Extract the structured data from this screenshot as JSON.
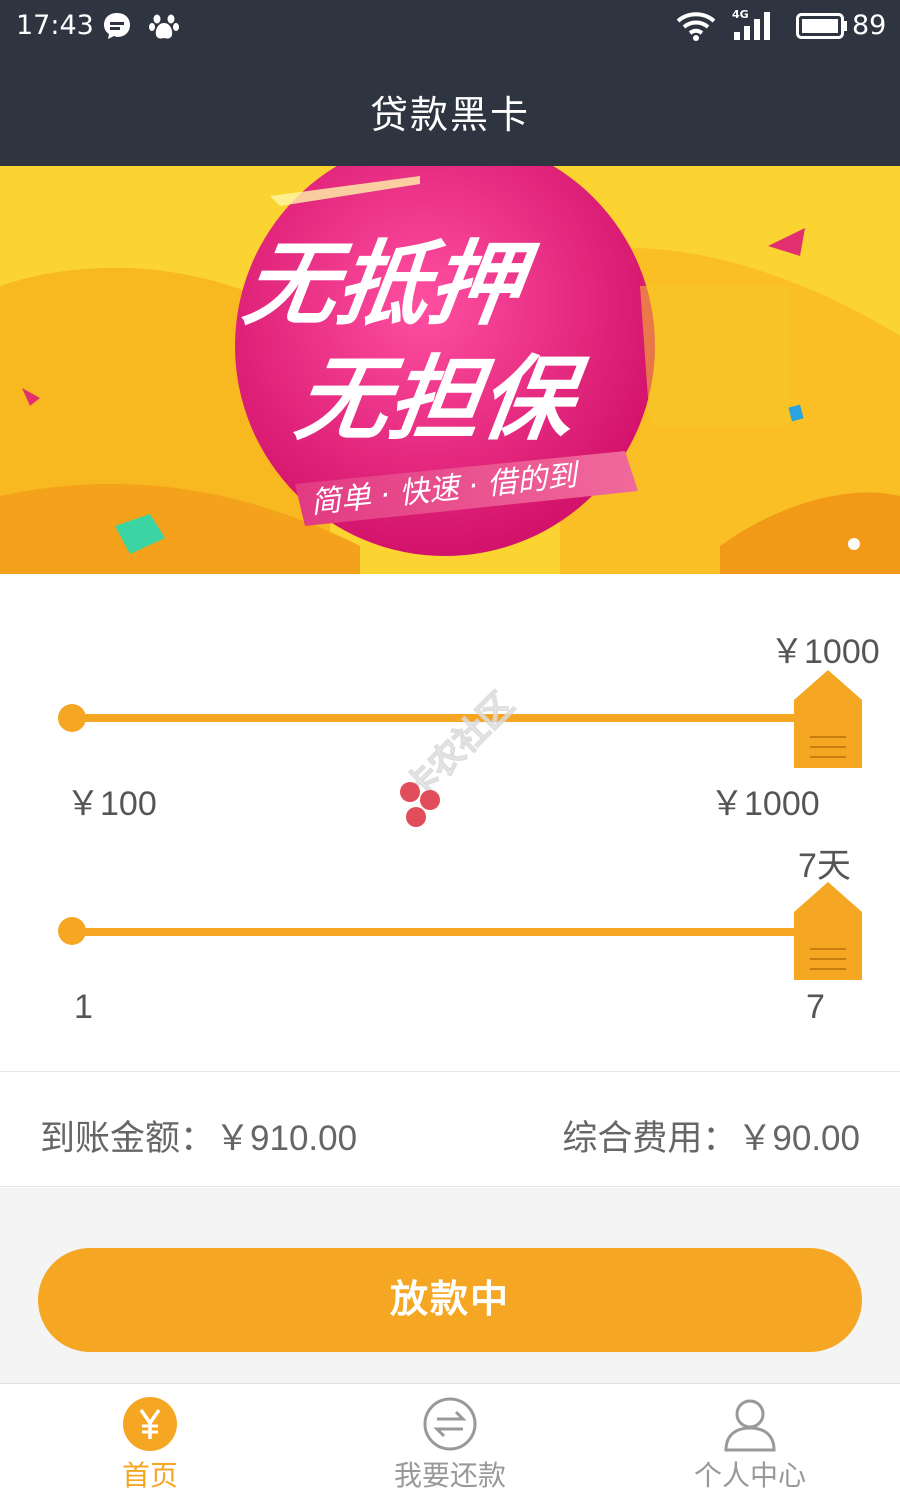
{
  "status_bar": {
    "time": "17:43",
    "network_label": "4G",
    "battery": "89"
  },
  "header": {
    "title": "贷款黑卡"
  },
  "banner": {
    "line1": "无抵押",
    "line2": "无担保",
    "tagline": "简单 · 快速 · 借的到",
    "slide_count": 1,
    "active_slide": 1
  },
  "amount_slider": {
    "current_label": "￥1000",
    "min_label": "￥100",
    "max_label": "￥1000",
    "min": 100,
    "max": 1000,
    "value": 1000
  },
  "days_slider": {
    "current_label": "7天",
    "min_label": "1",
    "max_label": "7",
    "min": 1,
    "max": 7,
    "value": 7
  },
  "watermark": {
    "text": "卡农社区"
  },
  "summary": {
    "received_label": "到账金额：",
    "received_value": "￥910.00",
    "fee_label": "综合费用：",
    "fee_value": "￥90.00"
  },
  "action": {
    "button_label": "放款中"
  },
  "tabs": [
    {
      "label": "首页",
      "icon": "yen-icon",
      "active": true
    },
    {
      "label": "我要还款",
      "icon": "exchange-icon",
      "active": false
    },
    {
      "label": "个人中心",
      "icon": "user-icon",
      "active": false
    }
  ],
  "colors": {
    "accent": "#f5a623",
    "header_bg": "#2f3441",
    "banner_yellow": "#f9c02a",
    "banner_pink": "#e6197a"
  }
}
